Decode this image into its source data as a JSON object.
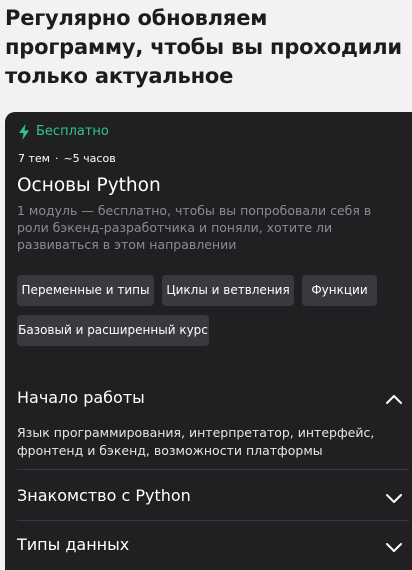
{
  "heading": "Регулярно обновляем программу, чтобы вы проходили только актуальное",
  "card": {
    "badge": "Бесплатно",
    "topics": "7 тем",
    "duration": "~5 часов",
    "title": "Основы Python",
    "description": "1 модуль — бесплатно, чтобы вы попробовали себя в роли бэкенд-разработчика и поняли, хотите ли развиваться в этом направлении",
    "tags": [
      "Переменные и типы",
      "Циклы и ветвления",
      "Функции",
      "Базовый и расширенный курс"
    ],
    "sections": [
      {
        "title": "Начало работы",
        "expanded": true,
        "text": "Язык программирования, интерпретатор, интерфейс, фронтенд и бэкенд, возможности платформы"
      },
      {
        "title": "Знакомство с Python",
        "expanded": false
      },
      {
        "title": "Типы данных",
        "expanded": false
      }
    ]
  },
  "colors": {
    "accent_green": "#31c48d",
    "card_bg": "#202023",
    "tag_bg": "#3a3a3e"
  }
}
